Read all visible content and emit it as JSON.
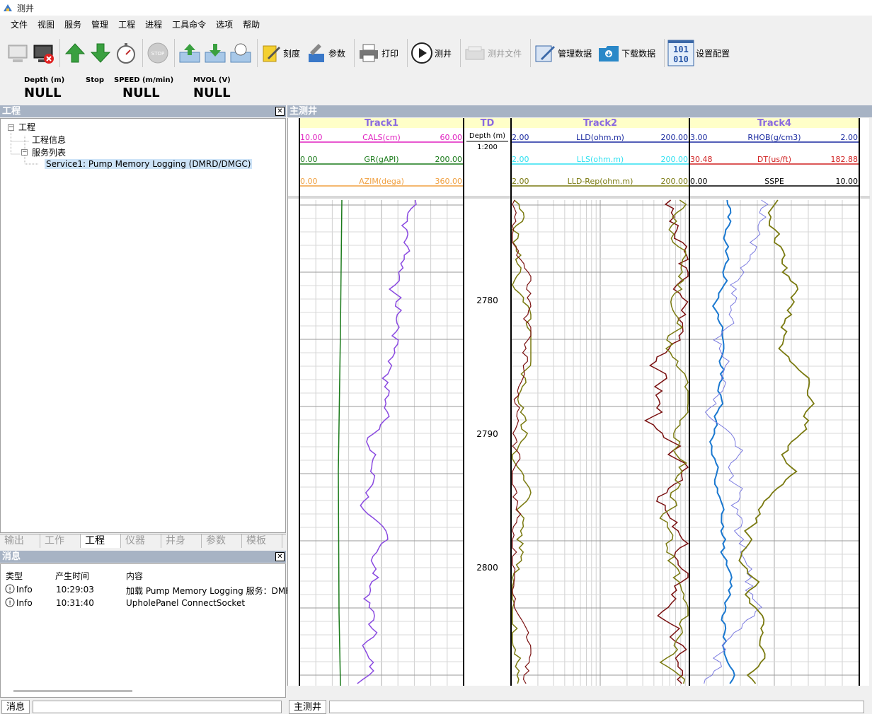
{
  "window": {
    "title": "测井"
  },
  "menu": [
    "文件",
    "视图",
    "服务",
    "管理",
    "工程",
    "进程",
    "工具命令",
    "选项",
    "帮助"
  ],
  "toolbar": {
    "scale_label": "刻度",
    "params_label": "参数",
    "print_label": "打印",
    "log_label": "测井",
    "logfile_label": "测井文件",
    "manage_label": "管理数据",
    "download_label": "下载数据",
    "config_label": "设置配置",
    "binary_icon_text": "101\n010"
  },
  "status": {
    "depth_h": "Depth (m)",
    "depth_v": "NULL",
    "stop_h": "Stop",
    "speed_h": "SPEED (m/min)",
    "speed_v": "NULL",
    "mvol_h": "MVOL (V)",
    "mvol_v": "NULL"
  },
  "project_panel": {
    "title": "工程",
    "tree": {
      "root": "工程",
      "info": "工程信息",
      "services": "服务列表",
      "service1": "Service1: Pump Memory Logging (DMRD/DMGC)"
    }
  },
  "tabs": [
    "输出",
    "工作",
    "工程",
    "仪器",
    "井身",
    "参数",
    "模板"
  ],
  "active_tab": "工程",
  "messages_panel": {
    "title": "消息",
    "headers": {
      "type": "类型",
      "time": "产生时间",
      "content": "内容"
    },
    "rows": [
      {
        "type": "Info",
        "time": "10:29:03",
        "content": "加载 Pump Memory Logging 服务：DMR"
      },
      {
        "type": "Info",
        "time": "10:31:40",
        "content": "UpholePanel ConnectSocket"
      }
    ]
  },
  "bottom_tabs": {
    "messages": "消息",
    "mainwell": "主测井"
  },
  "main_well": {
    "title": "主测井",
    "tracks": [
      {
        "name": "Track1",
        "curves": [
          {
            "left": "10.00",
            "name": "CALS(cm)",
            "right": "60.00",
            "color": "#e020c0"
          },
          {
            "left": "0.00",
            "name": "GR(gAPI)",
            "right": "200.00",
            "color": "#1a7a1a"
          },
          {
            "left": "0.00",
            "name": "AZIM(dega)",
            "right": "360.00",
            "color": "#f0a040"
          }
        ]
      },
      {
        "name": "TD",
        "depth_label": "Depth (m)",
        "scale": "1:200"
      },
      {
        "name": "Track2",
        "curves": [
          {
            "left": "2.00",
            "name": "LLD(ohm.m)",
            "right": "200.00",
            "color": "#1a2aa0"
          },
          {
            "left": "2.00",
            "name": "LLS(ohm.m)",
            "right": "200.00",
            "color": "#30e0f0"
          },
          {
            "left": "2.00",
            "name": "LLD-Rep(ohm.m)",
            "right": "200.00",
            "color": "#7a7a10"
          }
        ]
      },
      {
        "name": "Track4",
        "curves": [
          {
            "left": "3.00",
            "name": "RHOB(g/cm3)",
            "right": "2.00",
            "color": "#1a2aa0"
          },
          {
            "left": "30.48",
            "name": "DT(us/ft)",
            "right": "182.88",
            "color": "#d02020"
          },
          {
            "left": "0.00",
            "name": "SSPE",
            "right": "10.00",
            "color": "#000000"
          }
        ]
      }
    ],
    "depth_ticks": [
      "2780",
      "2790",
      "2800"
    ]
  }
}
